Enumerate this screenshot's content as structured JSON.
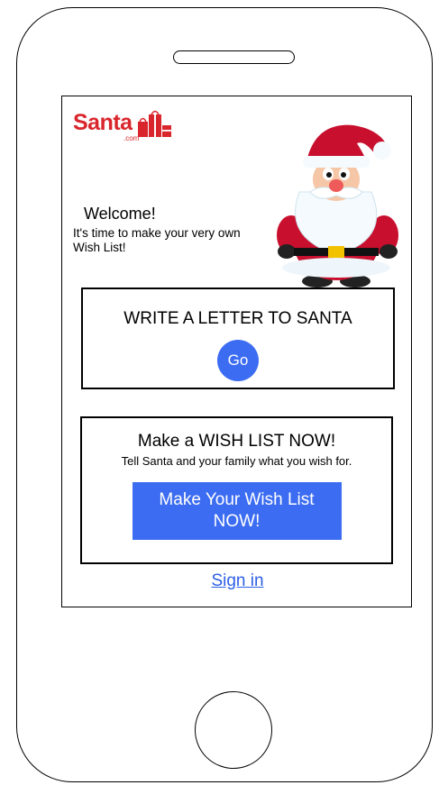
{
  "logo": {
    "word": "Santa",
    "sub": ".com"
  },
  "welcome": {
    "title": "Welcome!",
    "text": "It's time to make your very own Wish List!"
  },
  "letter_card": {
    "title": "WRITE A LETTER TO SANTA",
    "button_label": "Go"
  },
  "wish_card": {
    "title": "Make a WISH LIST NOW!",
    "subtitle": "Tell Santa and your family what you wish for.",
    "button_line1": "Make Your Wish List",
    "button_line2": "NOW!"
  },
  "sign_in_label": "Sign in",
  "colors": {
    "brand_red": "#d9262c",
    "button_blue": "#3c6cf1",
    "link_blue": "#2c5fe6"
  },
  "icons": [
    "gift-bag-icon",
    "santa-illustration"
  ]
}
